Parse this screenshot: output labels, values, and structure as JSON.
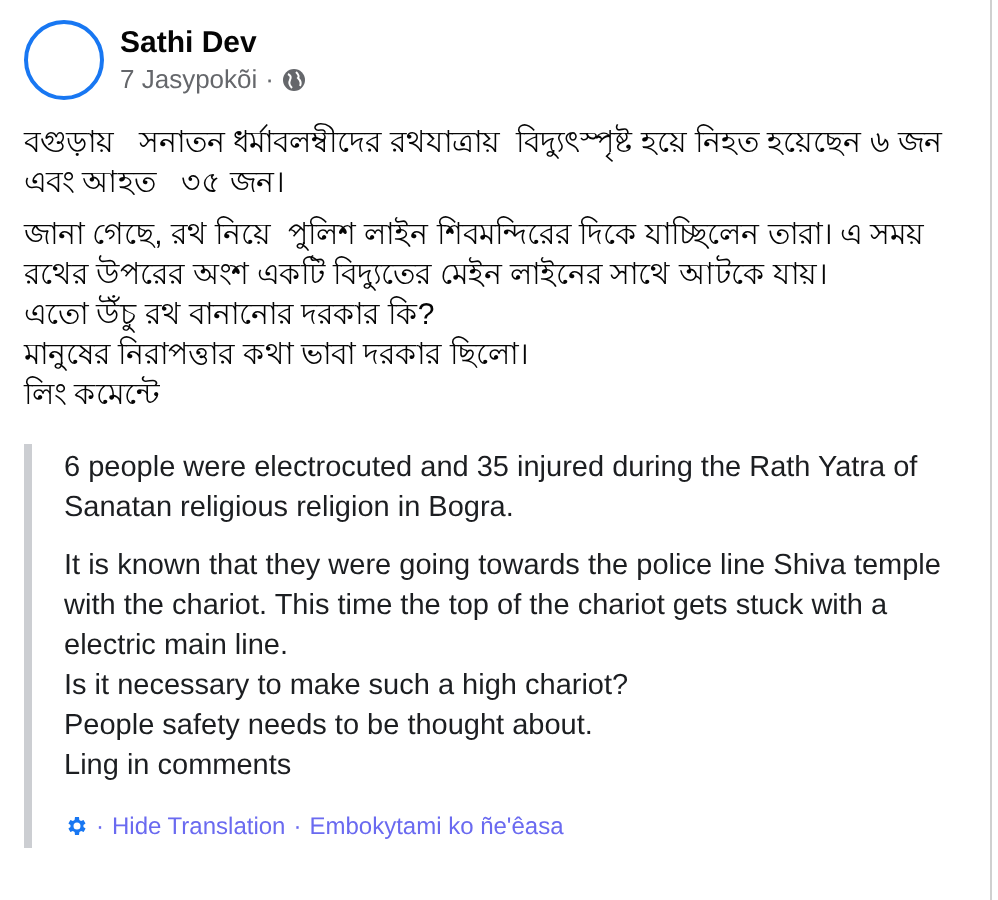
{
  "post": {
    "author": "Sathi Dev",
    "time": "7 Jasypokõi",
    "separator": "·",
    "paragraphs": [
      "বগুড়ায়   সনাতন ধর্মাবলম্বীদের রথযাত্রায়  বিদ্যুৎস্পৃষ্ট হয়ে নিহত হয়েছেন ৬ জন এবং আহত   ৩৫ জন।",
      "জানা গেছে, রথ নিয়ে  পুলিশ লাইন শিবমন্দিরের দিকে যাচ্ছিলেন তারা। এ সময় রথের উপরের অংশ একটি বিদ্যুতের মেইন লাইনের সাথে আটকে যায়।\nএতো উঁচু রথ বানানোর দরকার কি?\nমানুষের নিরাপত্তার কথা ভাবা দরকার ছিলো।\nলিং কমেন্টে"
    ]
  },
  "translation": {
    "paragraphs": [
      "6 people were electrocuted and 35 injured during the Rath Yatra of Sanatan religious religion in Bogra.",
      "It is known that they were going towards the police line Shiva temple with the chariot. This time the top of the chariot gets stuck with a electric main line.\nIs it necessary to make such a high chariot?\nPeople safety needs to be thought about.\nLing in comments"
    ],
    "footer": [
      {
        "kind": "icon"
      },
      {
        "kind": "separator",
        "text": "·"
      },
      {
        "kind": "link",
        "text": "Hide Translation"
      },
      {
        "kind": "separator",
        "text": "·"
      },
      {
        "kind": "link",
        "text": "Embokytami ko ñe'êasa"
      }
    ]
  }
}
